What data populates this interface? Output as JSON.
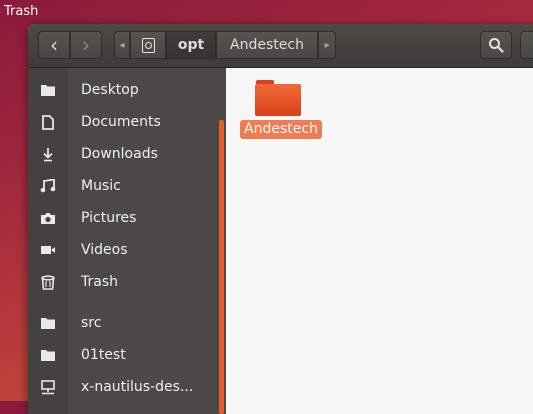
{
  "desktop": {
    "trash_label": "Trash"
  },
  "toolbar": {
    "back_icon": "‹",
    "forward_icon": "›",
    "path_left_icon": "◂",
    "path_right_icon": "▸",
    "path": [
      "opt",
      "Andestech"
    ]
  },
  "sidebar": {
    "items": [
      {
        "label": "Desktop",
        "icon": "folder-icon"
      },
      {
        "label": "Documents",
        "icon": "document-icon"
      },
      {
        "label": "Downloads",
        "icon": "download-icon"
      },
      {
        "label": "Music",
        "icon": "music-icon"
      },
      {
        "label": "Pictures",
        "icon": "camera-icon"
      },
      {
        "label": "Videos",
        "icon": "video-icon"
      },
      {
        "label": "Trash",
        "icon": "trash-icon"
      },
      {
        "label": "src",
        "icon": "folder-icon"
      },
      {
        "label": "01test",
        "icon": "folder-icon"
      },
      {
        "label": "x-nautilus-des...",
        "icon": "network-icon"
      }
    ]
  },
  "content": {
    "items": [
      {
        "label": "Andestech",
        "type": "folder"
      }
    ]
  },
  "colors": {
    "accent": "#e65e2a",
    "sidebar_bg": "#4a4945",
    "header_bg": "#3d3c38"
  }
}
